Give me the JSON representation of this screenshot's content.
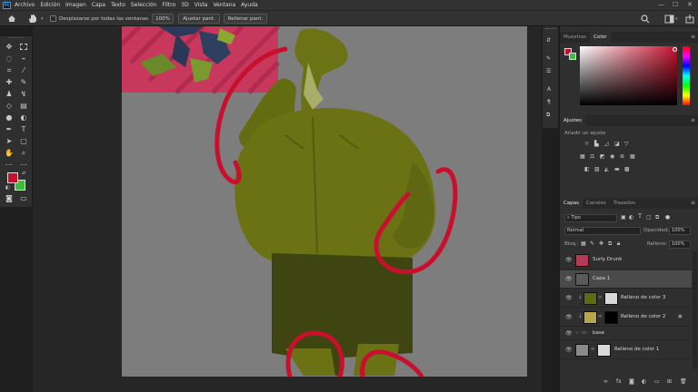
{
  "menu": {
    "logo": "Ps",
    "items": [
      "Archivo",
      "Edición",
      "Imagen",
      "Capa",
      "Texto",
      "Selección",
      "Filtro",
      "3D",
      "Vista",
      "Ventana",
      "Ayuda"
    ],
    "controls": [
      "—",
      "☐",
      "✕"
    ]
  },
  "options": {
    "scroll_all_label": "Desplazarse por todas las ventanas",
    "zoom_value": "100%",
    "fit_screen": "Ajustar pant.",
    "fill_screen": "Rellenar pant."
  },
  "swatches_panel": {
    "tabs": [
      "Muestras",
      "Color"
    ],
    "active_tab": "Color",
    "foreground_color": "#c8102e",
    "background_color": "#3dbb3d"
  },
  "adjustments_panel": {
    "tab": "Ajustes",
    "add_label": "Añadir un ajuste"
  },
  "layers_panel": {
    "tabs": [
      "Capas",
      "Canales",
      "Trazados"
    ],
    "filter_value": "Tipo",
    "blend_mode": "Normal",
    "opacity_label": "Opacidad:",
    "opacity_value": "100%",
    "lock_label": "Bloq.:",
    "fill_label": "Relleno:",
    "fill_value": "100%",
    "layers": [
      {
        "name": "Surly Drunk",
        "thumb_color": "#b33a5a",
        "selected": false,
        "indent": false
      },
      {
        "name": "Capa 1",
        "thumb_color": "#5a5a5a",
        "selected": true,
        "indent": false
      },
      {
        "name": "Relleno de color 3",
        "thumb_color": "#5c6b14",
        "mask_color": "#d9d9d9",
        "selected": false,
        "indent": true
      },
      {
        "name": "Relleno de color 2",
        "thumb_color": "#b8a64e",
        "mask_color": "#000000",
        "selected": false,
        "indent": true
      },
      {
        "name": "base",
        "thumb_color": "",
        "selected": false,
        "indent": false,
        "group": true
      },
      {
        "name": "Relleno de color 1",
        "thumb_color": "#8a8a8a",
        "mask_color": "#d9d9d9",
        "selected": false,
        "indent": false
      }
    ]
  }
}
